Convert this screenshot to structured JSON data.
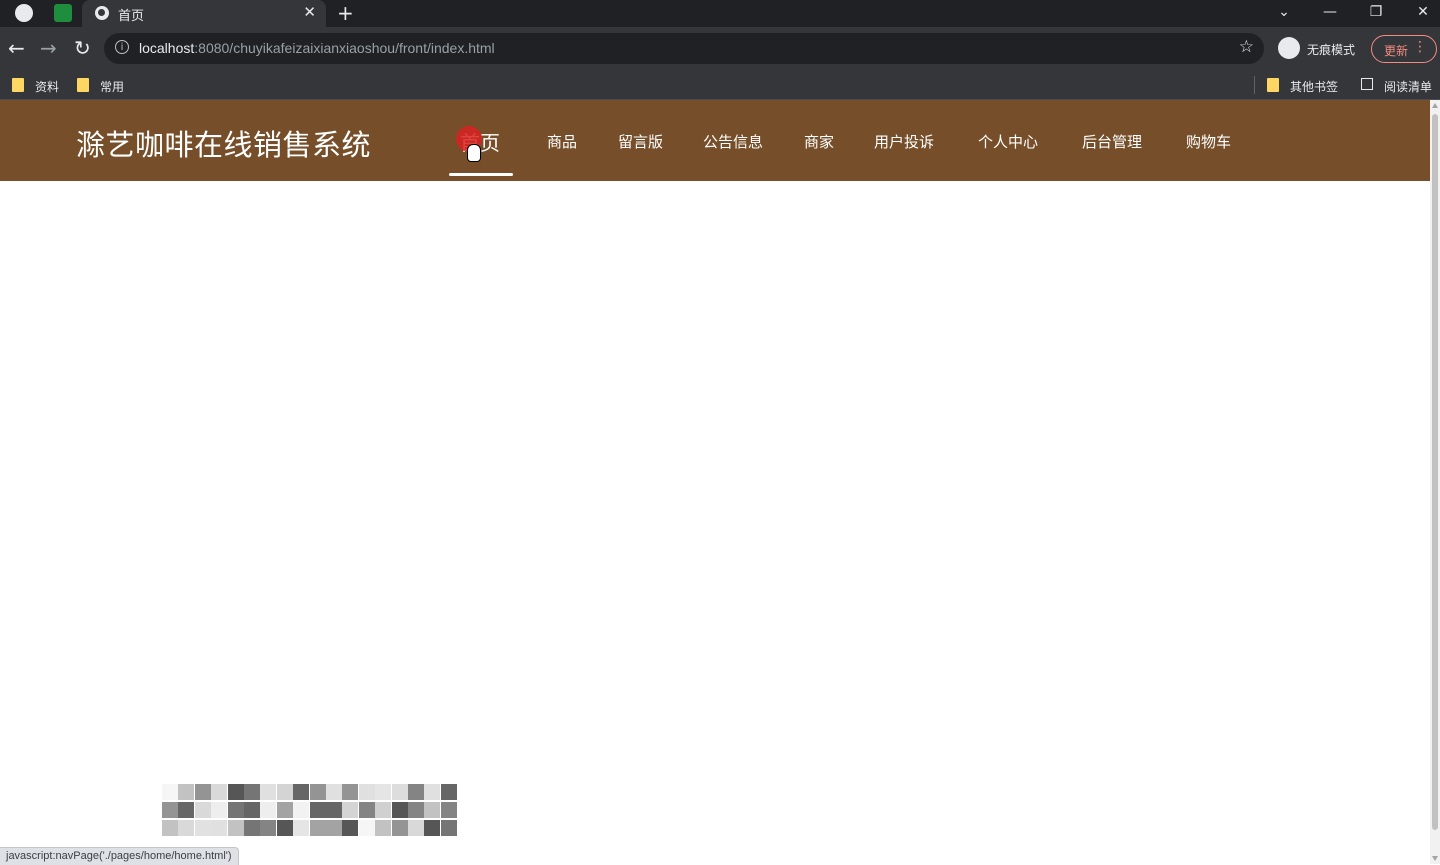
{
  "browser": {
    "tab": {
      "title": "首页"
    },
    "address_bar": {
      "host": "localhost",
      "path": ":8080/chuyikafeizaixianxiaoshou/front/index.html"
    },
    "profile_label": "无痕模式",
    "update_label": "更新",
    "bookmarks": [
      "资料",
      "常用"
    ],
    "bookmarks_right": {
      "other": "其他书签",
      "reading_list": "阅读清单"
    }
  },
  "site": {
    "title": "滁艺咖啡在线销售系统",
    "nav": [
      {
        "label": "首页",
        "active": true
      },
      {
        "label": "商品"
      },
      {
        "label": "留言版"
      },
      {
        "label": "公告信息"
      },
      {
        "label": "商家"
      },
      {
        "label": "用户投诉"
      },
      {
        "label": "个人中心"
      },
      {
        "label": "后台管理"
      },
      {
        "label": "购物车"
      }
    ],
    "header_color": "#764f2a"
  },
  "status_bar": {
    "text": "javascript:navPage('./pages/home/home.html')"
  }
}
